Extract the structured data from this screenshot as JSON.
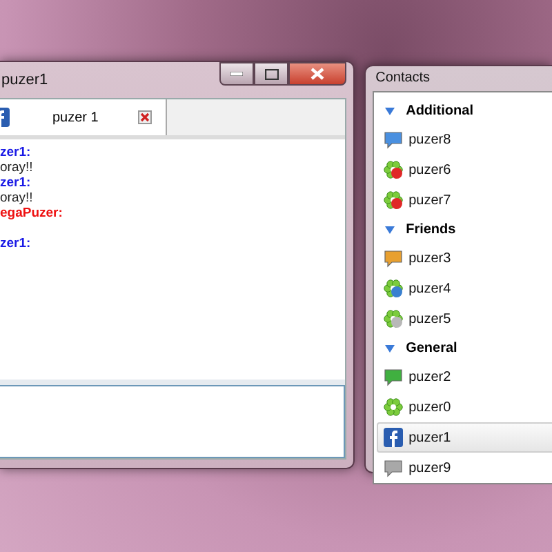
{
  "chat_window": {
    "title": "puzer1",
    "tabs": [
      {
        "label": "puzer 1",
        "selected": true
      }
    ],
    "messages": [
      {
        "sender": "zer1:",
        "color": "#1a1ae6",
        "lines": [
          "oray!!"
        ]
      },
      {
        "sender": "zer1:",
        "color": "#1a1ae6",
        "lines": [
          "oray!!"
        ]
      },
      {
        "sender": "egaPuzer:",
        "color": "#ee1111"
      },
      {
        "sender": "zer1:",
        "color": "#1a1ae6"
      }
    ]
  },
  "contacts_window": {
    "title": "Contacts",
    "groups": [
      {
        "name": "Additional",
        "expanded": true,
        "children": [
          {
            "name": "puzer8",
            "kind": "bubble",
            "color": "#4a90e0",
            "selected": false
          },
          {
            "name": "puzer6",
            "kind": "flower",
            "color": "#e02828",
            "selected": false
          },
          {
            "name": "puzer7",
            "kind": "flower",
            "color": "#e02828",
            "selected": false
          }
        ]
      },
      {
        "name": "Friends",
        "expanded": true,
        "children": [
          {
            "name": "puzer3",
            "kind": "bubble",
            "color": "#e8a030",
            "selected": false
          },
          {
            "name": "puzer4",
            "kind": "flower",
            "color": "#3a80d0",
            "selected": false
          },
          {
            "name": "puzer5",
            "kind": "flower",
            "color": "#b8b8b8",
            "selected": false
          }
        ]
      },
      {
        "name": "General",
        "expanded": true,
        "children": [
          {
            "name": "puzer2",
            "kind": "bubble",
            "color": "#40b040",
            "selected": false
          },
          {
            "name": "puzer0",
            "kind": "flower",
            "selected": false
          },
          {
            "name": "puzer1",
            "kind": "facebook",
            "selected": true
          },
          {
            "name": "puzer9",
            "kind": "bubble",
            "color": "#a8a8a8",
            "selected": false
          }
        ]
      }
    ]
  }
}
